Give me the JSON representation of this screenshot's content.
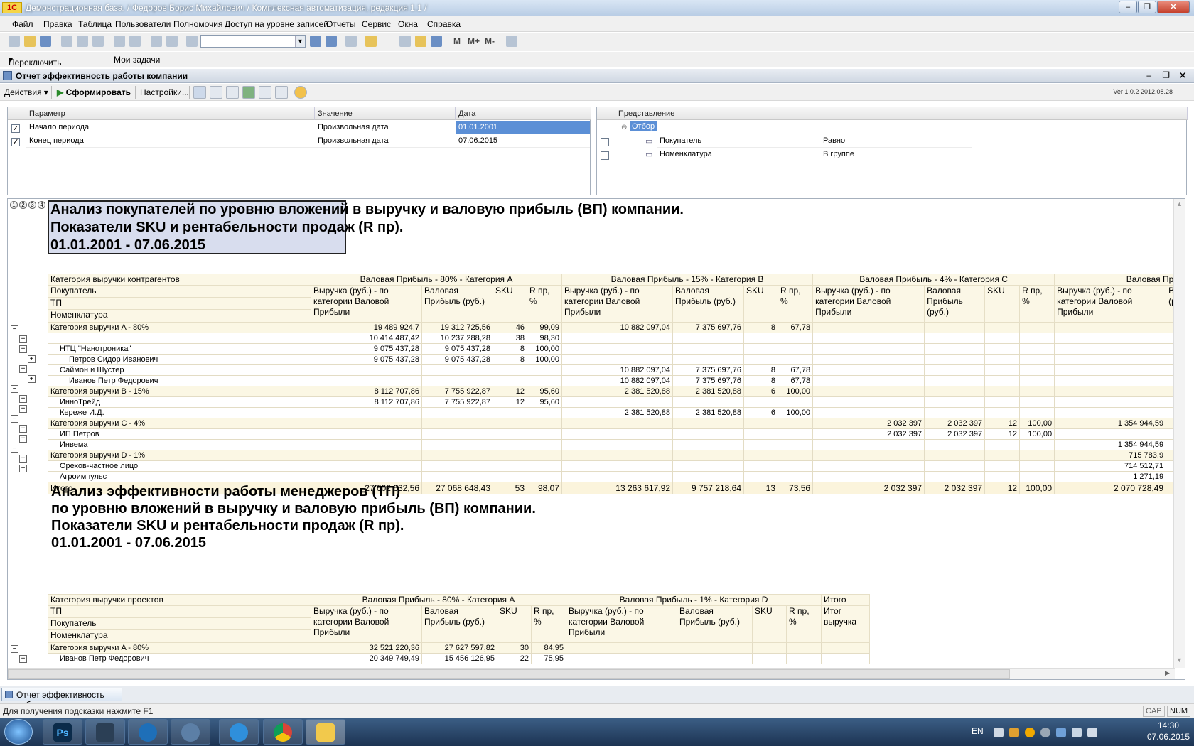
{
  "window": {
    "title": "Демонстрационная база. / Федоров Борис Михайлович /  Комплексная автоматизация, редакция 1.1 /"
  },
  "menu": [
    "Файл",
    "Правка",
    "Таблица",
    "Пользователи",
    "Полномочия",
    "Доступ на уровне записей",
    "Отчеты",
    "Сервис",
    "Окна",
    "Справка"
  ],
  "toolbar2": {
    "switch_interface": "Переключить интерфейс",
    "my_tasks": "Мои задачи"
  },
  "toolbar1": {
    "m": "М",
    "mplus": "М+",
    "mminus": "М-"
  },
  "form": {
    "title": "Отчет  эффективность работы компании",
    "actions": "Действия",
    "generate": "Сформировать",
    "settings": "Настройки...",
    "version": "Ver 1.0.2  2012.08.28"
  },
  "params": {
    "headers": [
      "Параметр",
      "Значение",
      "Дата"
    ],
    "rows": [
      {
        "name": "Начало периода",
        "value": "Произвольная дата",
        "date": "01.01.2001"
      },
      {
        "name": "Конец  периода",
        "value": "Произвольная дата",
        "date": "07.06.2015"
      }
    ]
  },
  "view": {
    "header": "Представление",
    "group": "Отбор",
    "rows": [
      {
        "field": "Покупатель",
        "cond": "Равно"
      },
      {
        "field": "Номенклатура",
        "cond": "В группе"
      }
    ]
  },
  "levels": [
    "1",
    "2",
    "3",
    "4"
  ],
  "report1": {
    "title": [
      "Анализ покупателей по уровню вложений в выручку и валовую прибыль (ВП) компании.",
      "Показатели SKU и рентабельности продаж (R пр).",
      "01.01.2001 - 07.06.2015"
    ],
    "group_headers": [
      "Валовая Прибыль - 80% - Категория  A",
      "Валовая Прибыль - 15% - Категория  B",
      "Валовая Прибыль - 4% - Категория  C",
      "Валовая Прибыль -"
    ],
    "row_headers": [
      "Категория выручки контрагентов",
      "Покупатель",
      "ТП",
      "Номенклатура"
    ],
    "col_headers": {
      "revenue": "Выручка (руб.) - по категории Валовой Прибыли",
      "profit": "Валовая Прибыль (руб.)",
      "sku": "SKU",
      "r": "R пр, %",
      "last_trunc": "Ва Пр (ру"
    },
    "rows": [
      {
        "label": "Категория выручки A - 80%",
        "cat": true,
        "cells": [
          "19 489 924,7",
          "19 312 725,56",
          "46",
          "99,09",
          "10 882 097,04",
          "7 375 697,76",
          "8",
          "67,78",
          "",
          "",
          "",
          "",
          ""
        ]
      },
      {
        "label": "",
        "cat": false,
        "cells": [
          "10 414 487,42",
          "10 237 288,28",
          "38",
          "98,30",
          "",
          "",
          "",
          "",
          "",
          "",
          "",
          "",
          ""
        ]
      },
      {
        "label": "НТЦ \"Нанотроника\"",
        "cat": false,
        "cells": [
          "9 075 437,28",
          "9 075 437,28",
          "8",
          "100,00",
          "",
          "",
          "",
          "",
          "",
          "",
          "",
          "",
          ""
        ]
      },
      {
        "label": "Петров Сидор Иванович",
        "cat": false,
        "cells": [
          "9 075 437,28",
          "9 075 437,28",
          "8",
          "100,00",
          "",
          "",
          "",
          "",
          "",
          "",
          "",
          "",
          ""
        ]
      },
      {
        "label": "Саймон и Шустер",
        "cat": false,
        "cells": [
          "",
          "",
          "",
          "",
          "10 882 097,04",
          "7 375 697,76",
          "8",
          "67,78",
          "",
          "",
          "",
          "",
          ""
        ]
      },
      {
        "label": "Иванов Петр Федорович",
        "cat": false,
        "cells": [
          "",
          "",
          "",
          "",
          "10 882 097,04",
          "7 375 697,76",
          "8",
          "67,78",
          "",
          "",
          "",
          "",
          ""
        ]
      },
      {
        "label": "Категория выручки B - 15%",
        "cat": true,
        "cells": [
          "8 112 707,86",
          "7 755 922,87",
          "12",
          "95,60",
          "2 381 520,88",
          "2 381 520,88",
          "6",
          "100,00",
          "",
          "",
          "",
          "",
          ""
        ]
      },
      {
        "label": "ИнноТрейд",
        "cat": false,
        "cells": [
          "8 112 707,86",
          "7 755 922,87",
          "12",
          "95,60",
          "",
          "",
          "",
          "",
          "",
          "",
          "",
          "",
          ""
        ]
      },
      {
        "label": "Кереже И.Д.",
        "cat": false,
        "cells": [
          "",
          "",
          "",
          "",
          "2 381 520,88",
          "2 381 520,88",
          "6",
          "100,00",
          "",
          "",
          "",
          "",
          ""
        ]
      },
      {
        "label": "Категория выручки C - 4%",
        "cat": true,
        "cells": [
          "",
          "",
          "",
          "",
          "",
          "",
          "",
          "",
          "2 032 397",
          "2 032 397",
          "12",
          "100,00",
          "1 354 944,59"
        ]
      },
      {
        "label": "ИП Петров",
        "cat": false,
        "cells": [
          "",
          "",
          "",
          "",
          "",
          "",
          "",
          "",
          "2 032 397",
          "2 032 397",
          "12",
          "100,00",
          ""
        ]
      },
      {
        "label": "Инвема",
        "cat": false,
        "cells": [
          "",
          "",
          "",
          "",
          "",
          "",
          "",
          "",
          "",
          "",
          "",
          "",
          "1 354 944,59"
        ]
      },
      {
        "label": "Категория выручки D - 1%",
        "cat": true,
        "cells": [
          "",
          "",
          "",
          "",
          "",
          "",
          "",
          "",
          "",
          "",
          "",
          "",
          "715 783,9"
        ]
      },
      {
        "label": "Орехов-частное лицо",
        "cat": false,
        "cells": [
          "",
          "",
          "",
          "",
          "",
          "",
          "",
          "",
          "",
          "",
          "",
          "",
          "714 512,71"
        ]
      },
      {
        "label": "Агроимпульс",
        "cat": false,
        "cells": [
          "",
          "",
          "",
          "",
          "",
          "",
          "",
          "",
          "",
          "",
          "",
          "",
          "1 271,19"
        ]
      }
    ],
    "total": {
      "label": "Итого",
      "cells": [
        "27 602 632,56",
        "27 068 648,43",
        "53",
        "98,07",
        "13 263 617,92",
        "9 757 218,64",
        "13",
        "73,56",
        "2 032 397",
        "2 032 397",
        "12",
        "100,00",
        "2 070 728,49"
      ]
    }
  },
  "report2": {
    "title": [
      "Анализ эффективности работы менеджеров (ТП)",
      "по уровню вложений в выручку и валовую прибыль (ВП) компании.",
      "Показатели SKU и рентабельности продаж (R пр).",
      "01.01.2001 - 07.06.2015"
    ],
    "group_headers": [
      "Валовая Прибыль - 80% - Категория  A",
      "Валовая Прибыль - 1% - Категория  D",
      "Итого"
    ],
    "row_headers": [
      "Категория выручки проектов",
      "ТП",
      "Покупатель",
      "Номенклатура"
    ],
    "total_col": "Итог выручка",
    "rows": [
      {
        "label": "Категория выручки A - 80%",
        "cells": [
          "32 521 220,36",
          "27 627 597,82",
          "30",
          "84,95"
        ]
      },
      {
        "label": "Иванов Петр Федорович",
        "cells": [
          "20 349 749,49",
          "15 456 126,95",
          "22",
          "75,95"
        ]
      }
    ]
  },
  "tab": {
    "label": "Отчет  эффективность раб..."
  },
  "status": {
    "hint": "Для получения подсказки нажмите F1",
    "cap": "CAP",
    "num": "NUM"
  },
  "taskbar": {
    "lang": "EN",
    "time": "14:30",
    "date": "07.06.2015"
  }
}
